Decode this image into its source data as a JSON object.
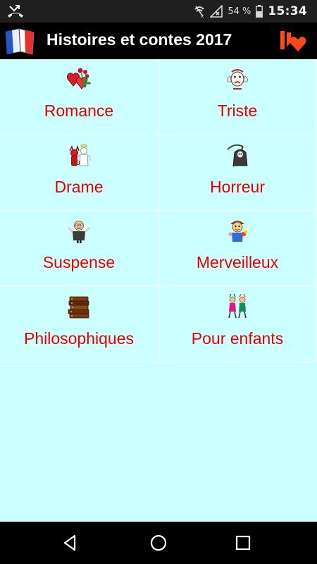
{
  "status_bar": {
    "battery_percent": "54 %",
    "time": "15:34",
    "icons": [
      "missed-call-icon",
      "wifi-off-icon",
      "signal-no-sim-icon",
      "battery-icon"
    ]
  },
  "app_bar": {
    "title": "Histoires et contes 2017",
    "logo_icon": "french-flag-book-icon",
    "action_icon": "unlike-heart-icon"
  },
  "categories": [
    {
      "label": "Romance",
      "icon": "hearts-roses-icon"
    },
    {
      "label": "Triste",
      "icon": "sad-face-icon"
    },
    {
      "label": "Drame",
      "icon": "devil-angel-icon"
    },
    {
      "label": "Horreur",
      "icon": "grim-reaper-icon"
    },
    {
      "label": "Suspense",
      "icon": "suspense-character-icon"
    },
    {
      "label": "Merveilleux",
      "icon": "wonder-character-icon"
    },
    {
      "label": "Philosophiques",
      "icon": "books-stack-icon"
    },
    {
      "label": "Pour enfants",
      "icon": "children-icon"
    }
  ],
  "nav_bar": {
    "icons": [
      "back-icon",
      "home-icon",
      "recents-icon"
    ]
  },
  "colors": {
    "background": "#ccffff",
    "label": "#e60000",
    "app_bar": "#000000",
    "status_bar": "#1f1f1f"
  }
}
